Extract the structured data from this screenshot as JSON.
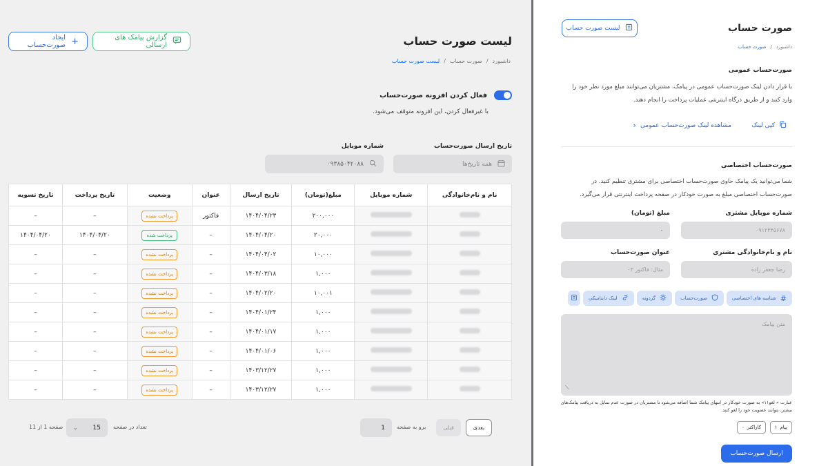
{
  "list": {
    "title": "لیست صورت حساب",
    "breadcrumb": [
      "داشبورد",
      "صورت حساب",
      "لیست صورت حساب"
    ],
    "btn_create": "ایجاد صورت‌حساب",
    "btn_report": "گزارش پیامک های ارسالی",
    "toggle_label": "فعال کردن افزونه صورت‌حساب",
    "toggle_help": "با غیرفعال کردن، این افزونه متوقف می‌شود.",
    "filter_date_label": "تاریخ ارسال صورت‌حساب",
    "filter_date_placeholder": "همه تاریخ‌ها",
    "filter_mobile_label": "شماره موبایل",
    "filter_mobile_value": "۰۹۳۸۵۰۴۲۰۸۸",
    "columns": [
      "نام و نام‌خانوادگی",
      "شماره موبایل",
      "مبلغ(تومان)",
      "تاریخ ارسال",
      "عنوان",
      "وضعیت",
      "تاریخ پرداخت",
      "تاریخ تسویه"
    ],
    "rows": [
      {
        "amount": "۲۰۰,۰۰۰",
        "sent": "۱۴۰۴/۰۴/۲۳",
        "title": "فاکتور",
        "status": "پرداخت نشده",
        "paid": false,
        "pay_date": "–",
        "settle_date": "–"
      },
      {
        "amount": "۲۰,۰۰۰",
        "sent": "۱۴۰۴/۰۴/۲۰",
        "title": "–",
        "status": "پرداخت شده",
        "paid": true,
        "pay_date": "۱۴۰۴/۰۴/۲۰",
        "settle_date": "۱۴۰۴/۰۴/۲۰"
      },
      {
        "amount": "۱۰,۰۰۰",
        "sent": "۱۴۰۴/۰۴/۰۲",
        "title": "–",
        "status": "پرداخت نشده",
        "paid": false,
        "pay_date": "–",
        "settle_date": "–"
      },
      {
        "amount": "۱,۰۰۰",
        "sent": "۱۴۰۴/۰۳/۱۸",
        "title": "–",
        "status": "پرداخت نشده",
        "paid": false,
        "pay_date": "–",
        "settle_date": "–"
      },
      {
        "amount": "۱۰,۰۰۱",
        "sent": "۱۴۰۴/۰۲/۲۰",
        "title": "–",
        "status": "پرداخت نشده",
        "paid": false,
        "pay_date": "–",
        "settle_date": "–"
      },
      {
        "amount": "۱,۰۰۰",
        "sent": "۱۴۰۴/۰۱/۲۴",
        "title": "–",
        "status": "پرداخت نشده",
        "paid": false,
        "pay_date": "–",
        "settle_date": "–"
      },
      {
        "amount": "۱,۰۰۰",
        "sent": "۱۴۰۴/۰۱/۱۷",
        "title": "–",
        "status": "پرداخت نشده",
        "paid": false,
        "pay_date": "–",
        "settle_date": "–"
      },
      {
        "amount": "۱,۰۰۰",
        "sent": "۱۴۰۴/۰۱/۰۶",
        "title": "–",
        "status": "پرداخت نشده",
        "paid": false,
        "pay_date": "–",
        "settle_date": "–"
      },
      {
        "amount": "۱,۰۰۰",
        "sent": "۱۴۰۳/۱۲/۲۷",
        "title": "–",
        "status": "پرداخت نشده",
        "paid": false,
        "pay_date": "–",
        "settle_date": "–"
      },
      {
        "amount": "۱,۰۰۰",
        "sent": "۱۴۰۳/۱۲/۲۷",
        "title": "–",
        "status": "پرداخت نشده",
        "paid": false,
        "pay_date": "–",
        "settle_date": "–"
      }
    ],
    "pager": {
      "next": "بعدی",
      "prev": "قبلی",
      "goto_label": "برو به صفحه",
      "goto_value": "1",
      "per_page_label": "تعداد در صفحه",
      "per_page_value": "15",
      "page_info": "صفحه 1 از 11"
    }
  },
  "form": {
    "title": "صورت حساب",
    "breadcrumb": [
      "داشبورد",
      "صورت حساب"
    ],
    "list_btn": "لیست صورت حساب",
    "public_heading": "صورت‌حساب عمومی",
    "public_desc": "با قرار دادن لینک صورت‌حساب عمومی در پیامک، مشتریان می‌توانند مبلغ مورد نظر خود را وارد کنند و از طریق درگاه اینترنتی عملیات پرداخت را انجام دهند.",
    "copy_link": "کپی لینک",
    "view_link": "مشاهده لینک صورت‌حساب عمومی",
    "private_heading": "صورت‌حساب اختصاصی",
    "private_desc": "شما می‌توانید یک پیامک حاوی صورت‌حساب اختصاصی برای مشتری تنظیم کنید. در صورت‌حساب اختصاصی مبلغ به صورت خودکار در صفحه پرداخت اینترنتی قرار می‌گیرد.",
    "mobile_label": "شماره موبایل مشتری",
    "mobile_placeholder": "۰۹۱۲۳۴۵۶۷۸",
    "amount_label": "مبلغ (تومان)",
    "amount_value": "۰",
    "name_label": "نام و نام‌خانوادگی مشتری",
    "name_placeholder": "رضا جعفر زاده",
    "invoice_title_label": "عنوان صورت‌حساب",
    "invoice_title_placeholder": "مثال: فاکتور ۰۳",
    "chips": [
      "شناسه های اختصاصی",
      "صورت‌حساب",
      "گردونه",
      "لینک داینامیکی"
    ],
    "message_placeholder": "متن پیامک",
    "note": "عبارت « لغو۱۱» به صورت خودکار در انتهای پیامک شما اضافه می‌شود تا مشتریان در صورت عدم تمایل به دریافت پیامک‌های بیشتر، بتوانند عضویت خود را لغو کنند.",
    "counter_sms": "پیام",
    "counter_sms_value": "۱",
    "counter_chars": "کاراکتر",
    "counter_chars_value": "۰",
    "send_btn": "ارسال صورت‌حساب"
  }
}
